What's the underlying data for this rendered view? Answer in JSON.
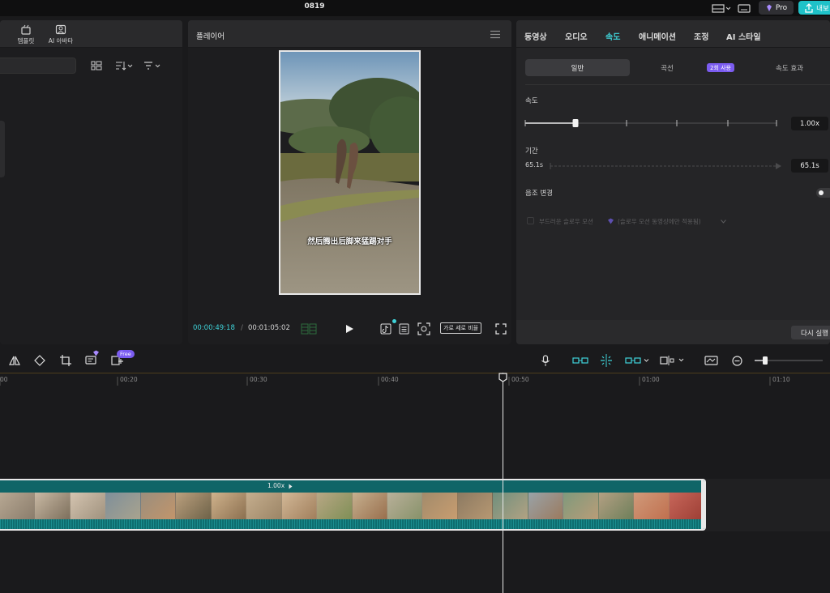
{
  "app": {
    "project_title": "0819",
    "pro_label": "Pro",
    "export_label": "내보"
  },
  "left_panel": {
    "tools": [
      {
        "label": "템플릿",
        "icon": "template-icon"
      },
      {
        "label": "AI 아바타",
        "icon": "avatar-icon"
      }
    ]
  },
  "player": {
    "title": "플레이어",
    "subtitle_text": "然后腾出后脚来猛踢对手",
    "current_time": "00:00:49:18",
    "separator": "/",
    "total_time": "00:01:05:02",
    "ratio_label": "가로 세로 비율"
  },
  "inspector": {
    "tabs": [
      {
        "label": "동영상",
        "active": false
      },
      {
        "label": "오디오",
        "active": false
      },
      {
        "label": "속도",
        "active": true
      },
      {
        "label": "애니메이션",
        "active": false
      },
      {
        "label": "조정",
        "active": false
      },
      {
        "label": "AI 스타일",
        "active": false
      }
    ],
    "segments": [
      {
        "label": "일반",
        "active": true
      },
      {
        "label": "곡선",
        "active": false
      },
      {
        "label": "속도 효과",
        "active": false
      }
    ],
    "badge": "2회 사용",
    "speed_label": "속도",
    "speed_value": "1.00x",
    "speed_fraction": 0.2,
    "duration_label": "기간",
    "duration_from": "65.1s",
    "duration_value": "65.1s",
    "pitch_label": "음조 변경",
    "smooth_slow_label": "부드러운 슬로우 모션",
    "smooth_slow_note": "(슬로우 모션 동영상에만 적용됨)",
    "reset_label": "다시 실행"
  },
  "toolbar": {
    "free_badge": "Free"
  },
  "timeline": {
    "ruler_labels": [
      "00",
      "00:20",
      "00:30",
      "00:40",
      "00:50",
      "01:00",
      "01:10"
    ],
    "clip_speed": "1.00x"
  },
  "colors": {
    "accent": "#3fd3d9",
    "clip": "#0e6d6f",
    "badge": "#7b5cf0"
  }
}
